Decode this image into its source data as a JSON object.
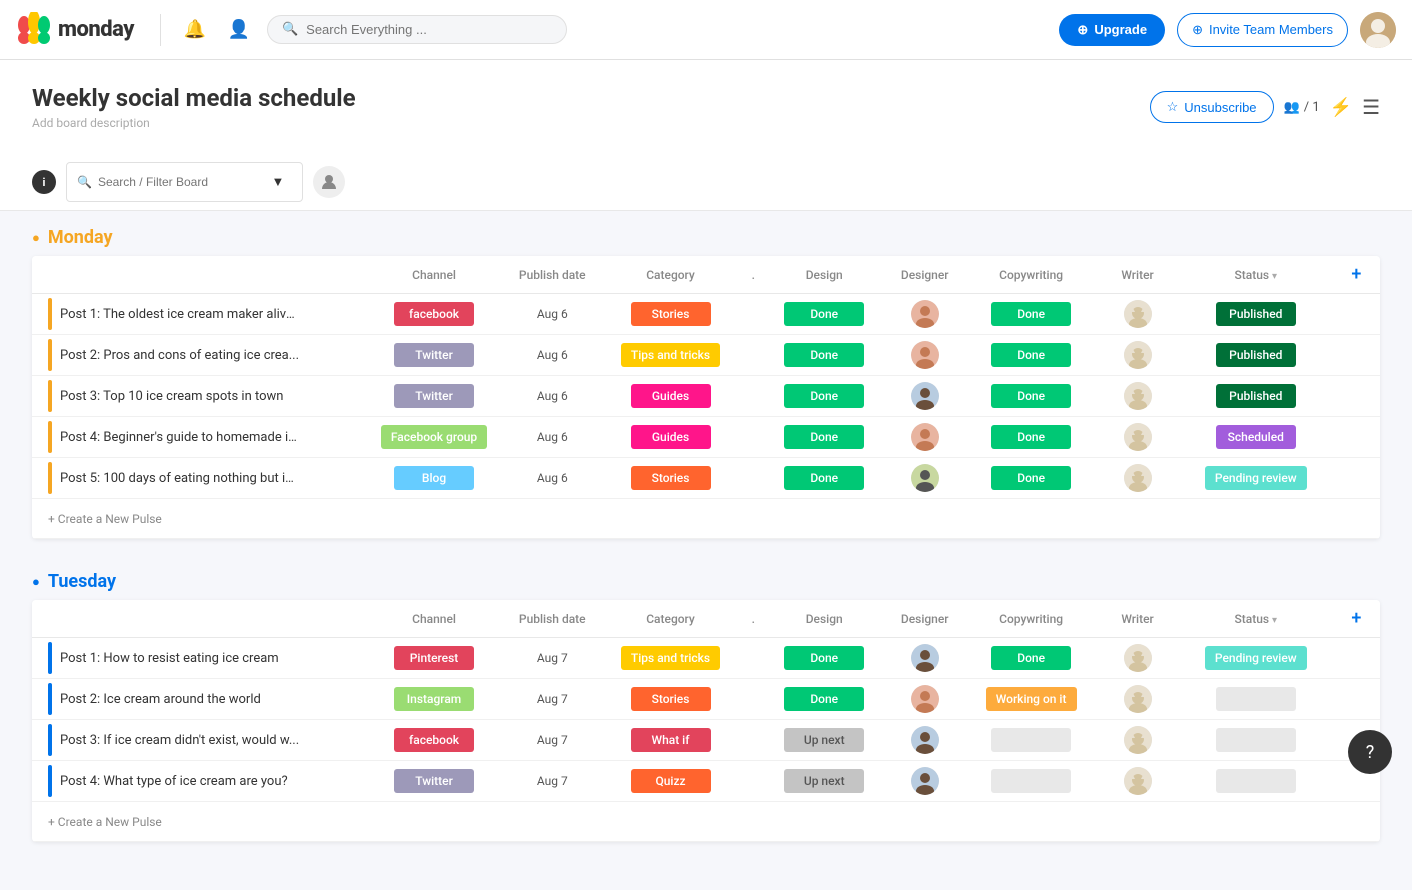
{
  "header": {
    "logo_alt": "monday.com",
    "search_placeholder": "Search Everything ...",
    "upgrade_label": "Upgrade",
    "invite_label": "Invite Team Members",
    "members_count": "/ 1"
  },
  "board": {
    "title": "Weekly social media schedule",
    "description": "Add board description",
    "unsubscribe_label": "Unsubscribe",
    "members_label": "/ 1"
  },
  "filter_bar": {
    "search_placeholder": "Search / Filter Board"
  },
  "columns": {
    "channel": "Channel",
    "publish_date": "Publish date",
    "category": "Category",
    "design": "Design",
    "designer": "Designer",
    "copywriting": "Copywriting",
    "writer": "Writer",
    "status": "Status"
  },
  "groups": [
    {
      "id": "monday",
      "title": "Monday",
      "color": "#f5a623",
      "indicator_color": "#f5a623",
      "rows": [
        {
          "name": "Post 1: The oldest ice cream maker alive...",
          "indicator": "#f5a623",
          "channel": "facebook",
          "channel_color": "#e2445c",
          "publish_date": "Aug 6",
          "category": "Stories",
          "category_color": "#ff642e",
          "design": "Done",
          "design_color": "#00c875",
          "copywriting": "Done",
          "copywriting_color": "#00c875",
          "status": "Published",
          "status_color": "#007038",
          "designer_avatar": "woman1",
          "writer_avatar": "cat"
        },
        {
          "name": "Post 2: Pros and cons of eating ice crea...",
          "indicator": "#f5a623",
          "channel": "Twitter",
          "channel_color": "#9d99b9",
          "publish_date": "Aug 6",
          "category": "Tips and tricks",
          "category_color": "#ffcb00",
          "design": "Done",
          "design_color": "#00c875",
          "copywriting": "Done",
          "copywriting_color": "#00c875",
          "status": "Published",
          "status_color": "#007038",
          "designer_avatar": "woman1",
          "writer_avatar": "cat"
        },
        {
          "name": "Post 3: Top 10 ice cream spots in town",
          "indicator": "#f5a623",
          "channel": "Twitter",
          "channel_color": "#9d99b9",
          "publish_date": "Aug 6",
          "category": "Guides",
          "category_color": "#ff158a",
          "design": "Done",
          "design_color": "#00c875",
          "copywriting": "Done",
          "copywriting_color": "#00c875",
          "status": "Published",
          "status_color": "#007038",
          "designer_avatar": "man1",
          "writer_avatar": "cat"
        },
        {
          "name": "Post 4: Beginner's guide to homemade ic...",
          "indicator": "#f5a623",
          "channel": "Facebook group",
          "channel_color": "#9adc72",
          "publish_date": "Aug 6",
          "category": "Guides",
          "category_color": "#ff158a",
          "design": "Done",
          "design_color": "#00c875",
          "copywriting": "Done",
          "copywriting_color": "#00c875",
          "status": "Scheduled",
          "status_color": "#a25ddc",
          "designer_avatar": "woman1",
          "writer_avatar": "cat"
        },
        {
          "name": "Post 5: 100 days of eating nothing but ic...",
          "indicator": "#f5a623",
          "channel": "Blog",
          "channel_color": "#66ccff",
          "publish_date": "Aug 6",
          "category": "Stories",
          "category_color": "#ff642e",
          "design": "Done",
          "design_color": "#00c875",
          "copywriting": "Done",
          "copywriting_color": "#00c875",
          "status": "Pending review",
          "status_color": "#5ce0cf",
          "designer_avatar": "man2",
          "writer_avatar": "cat"
        }
      ],
      "create_label": "+ Create a New Pulse"
    },
    {
      "id": "tuesday",
      "title": "Tuesday",
      "color": "#0073ea",
      "indicator_color": "#0073ea",
      "rows": [
        {
          "name": "Post 1: How to resist eating ice cream",
          "indicator": "#0073ea",
          "channel": "Pinterest",
          "channel_color": "#e2445c",
          "publish_date": "Aug 7",
          "category": "Tips and tricks",
          "category_color": "#ffcb00",
          "design": "Done",
          "design_color": "#00c875",
          "copywriting": "Done",
          "copywriting_color": "#00c875",
          "status": "Pending review",
          "status_color": "#5ce0cf",
          "designer_avatar": "man1",
          "writer_avatar": "cat"
        },
        {
          "name": "Post 2: Ice cream around the world",
          "indicator": "#0073ea",
          "channel": "Instagram",
          "channel_color": "#9adc72",
          "publish_date": "Aug 7",
          "category": "Stories",
          "category_color": "#ff642e",
          "design": "Done",
          "design_color": "#00c875",
          "copywriting": "Working on it",
          "copywriting_color": "#fdab3d",
          "status": "",
          "status_color": "#e8e8e8",
          "designer_avatar": "woman1",
          "writer_avatar": "cat"
        },
        {
          "name": "Post 3: If ice cream didn't exist, would w...",
          "indicator": "#0073ea",
          "channel": "facebook",
          "channel_color": "#e2445c",
          "publish_date": "Aug 7",
          "category": "What if",
          "category_color": "#e2445c",
          "design": "Up next",
          "design_color": "#c4c4c4",
          "copywriting": "",
          "copywriting_color": "#e8e8e8",
          "status": "",
          "status_color": "#e8e8e8",
          "designer_avatar": "man1",
          "writer_avatar": "cat"
        },
        {
          "name": "Post 4: What type of ice cream are you?",
          "indicator": "#0073ea",
          "channel": "Twitter",
          "channel_color": "#9d99b9",
          "publish_date": "Aug 7",
          "category": "Quizz",
          "category_color": "#ff642e",
          "design": "Up next",
          "design_color": "#c4c4c4",
          "copywriting": "",
          "copywriting_color": "#e8e8e8",
          "status": "",
          "status_color": "#e8e8e8",
          "designer_avatar": "man1",
          "writer_avatar": "cat"
        }
      ],
      "create_label": "+ Create a New Pulse"
    }
  ]
}
